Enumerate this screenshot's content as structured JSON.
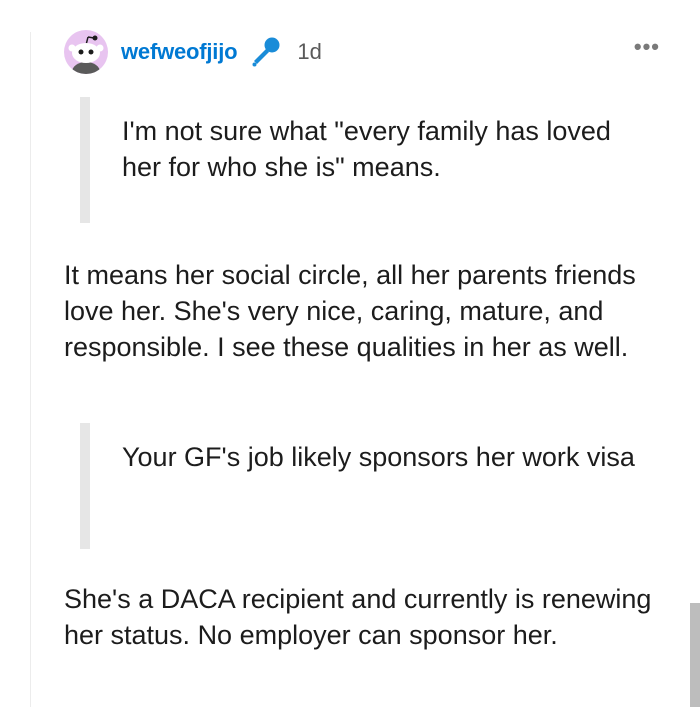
{
  "comment": {
    "username": "wefweofjijo",
    "age": "1d",
    "more_label": "•••",
    "badge_icon": "microphone-icon",
    "avatar_icon": "reddit-alien-avatar",
    "colors": {
      "username": "#0079d3",
      "avatar_bg": "#e8c4f0",
      "badge": "#1a8cd8",
      "quote_bar": "#e6e6e6"
    },
    "blocks": [
      {
        "kind": "quote",
        "text": "I'm not sure what \"every family has loved her for who she is\" means."
      },
      {
        "kind": "paragraph",
        "text": "It means her social circle, all her parents friends love her. She's very nice, caring, mature, and responsible. I see these qualities in her as well."
      },
      {
        "kind": "quote",
        "text": "Your GF's job likely sponsors her work visa"
      },
      {
        "kind": "paragraph",
        "text": "She's a DACA recipient and currently is renewing her status. No employer can sponsor her."
      }
    ]
  }
}
